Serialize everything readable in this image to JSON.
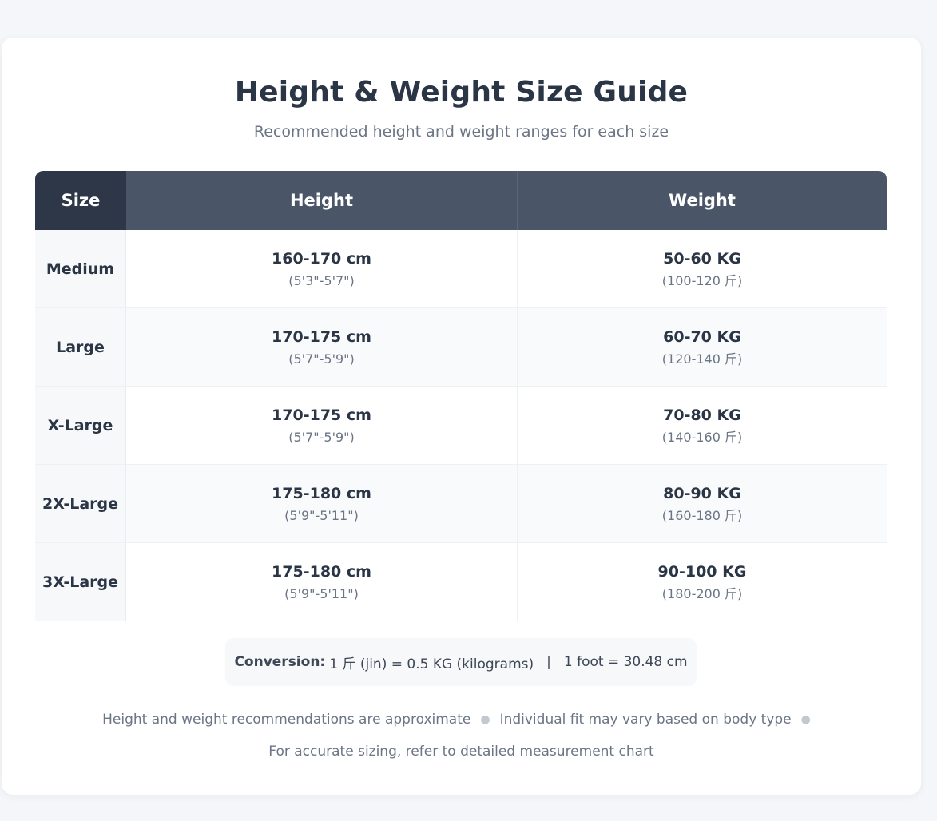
{
  "page": {
    "title": "Height & Weight Size Guide",
    "subtitle": "Recommended height and weight ranges for each size"
  },
  "table": {
    "headers": {
      "size": "Size",
      "height": "Height",
      "weight": "Weight"
    },
    "rows": [
      {
        "size": "Medium",
        "height": "160-170 cm",
        "height_imperial": "(5'3\"-5'7\")",
        "weight": "50-60 KG",
        "weight_jin": "(100-120 斤)"
      },
      {
        "size": "Large",
        "height": "170-175 cm",
        "height_imperial": "(5'7\"-5'9\")",
        "weight": "60-70 KG",
        "weight_jin": "(120-140 斤)"
      },
      {
        "size": "X-Large",
        "height": "170-175 cm",
        "height_imperial": "(5'7\"-5'9\")",
        "weight": "70-80 KG",
        "weight_jin": "(140-160 斤)"
      },
      {
        "size": "2X-Large",
        "height": "175-180 cm",
        "height_imperial": "(5'9\"-5'11\")",
        "weight": "80-90 KG",
        "weight_jin": "(160-180 斤)"
      },
      {
        "size": "3X-Large",
        "height": "175-180 cm",
        "height_imperial": "(5'9\"-5'11\")",
        "weight": "90-100 KG",
        "weight_jin": "(180-200 斤)"
      }
    ]
  },
  "conversion": {
    "label": "Conversion:",
    "weight_text": "1 斤 (jin) = 0.5 KG (kilograms)",
    "separator": "|",
    "length_text": "1 foot = 30.48 cm"
  },
  "notes": {
    "items": [
      "Height and weight recommendations are approximate",
      "Individual fit may vary based on body type",
      "For accurate sizing, refer to detailed measurement chart"
    ]
  },
  "colors": {
    "header_dark": "#2d3748",
    "header": "#4a5568",
    "text": "#2a3545",
    "muted": "#6b7585"
  }
}
